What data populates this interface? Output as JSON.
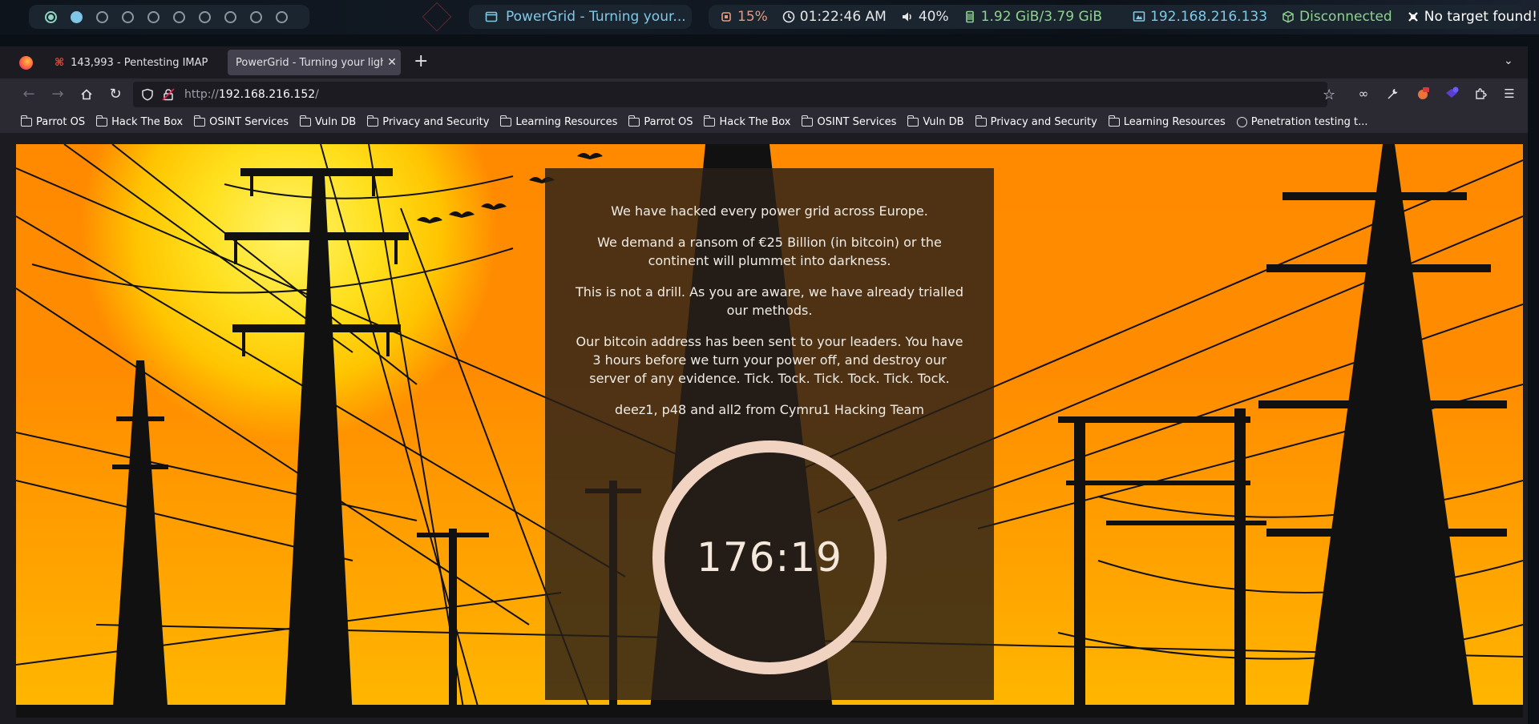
{
  "sysbar": {
    "workspaces": 10,
    "current_workspace": 1,
    "active_workspace": 2,
    "window_title": "PowerGrid - Turning your...",
    "cpu": "15%",
    "time": "01:22:46 AM",
    "volume": "40%",
    "memory": "1.92 GiB/3.79 GiB",
    "ip": "192.168.216.133",
    "vpn": "Disconnected",
    "target": "No target found!"
  },
  "tabs": [
    {
      "label": "143,993 - Pentesting IMAP",
      "favicon": "hackthebox-icon",
      "active": false
    },
    {
      "label": "PowerGrid - Turning your lights off",
      "active": true
    }
  ],
  "url": {
    "scheme": "http://",
    "host": "192.168.216.152",
    "path": "/"
  },
  "bookmarks": [
    {
      "label": "Parrot OS",
      "icon": "folder-icon"
    },
    {
      "label": "Hack The Box",
      "icon": "folder-icon"
    },
    {
      "label": "OSINT Services",
      "icon": "folder-icon"
    },
    {
      "label": "Vuln DB",
      "icon": "folder-icon"
    },
    {
      "label": "Privacy and Security",
      "icon": "folder-icon"
    },
    {
      "label": "Learning Resources",
      "icon": "folder-icon"
    },
    {
      "label": "Parrot OS",
      "icon": "folder-icon"
    },
    {
      "label": "Hack The Box",
      "icon": "folder-icon"
    },
    {
      "label": "OSINT Services",
      "icon": "folder-icon"
    },
    {
      "label": "Vuln DB",
      "icon": "folder-icon"
    },
    {
      "label": "Privacy and Security",
      "icon": "folder-icon"
    },
    {
      "label": "Learning Resources",
      "icon": "folder-icon"
    },
    {
      "label": "Penetration testing t...",
      "icon": "globe-icon"
    }
  ],
  "page": {
    "messages": [
      "We have hacked every power grid across Europe.",
      "We demand a ransom of €25 Billion (in bitcoin) or the continent will plummet into darkness.",
      "This is not a drill. As you are aware, we have already trialled our methods.",
      "Our bitcoin address has been sent to your leaders. You have 3 hours before we turn your power off, and destroy our server of any evidence. Tick. Tock. Tick. Tock. Tick. Tock.",
      "deez1, p48 and all2 from Cymru1 Hacking Team"
    ],
    "countdown": "176:19"
  },
  "colors": {
    "sky_orange": "#ff8c00",
    "sun_yellow": "#ffe01e",
    "panel": "#281e19",
    "ring": "#f1d3c2"
  }
}
